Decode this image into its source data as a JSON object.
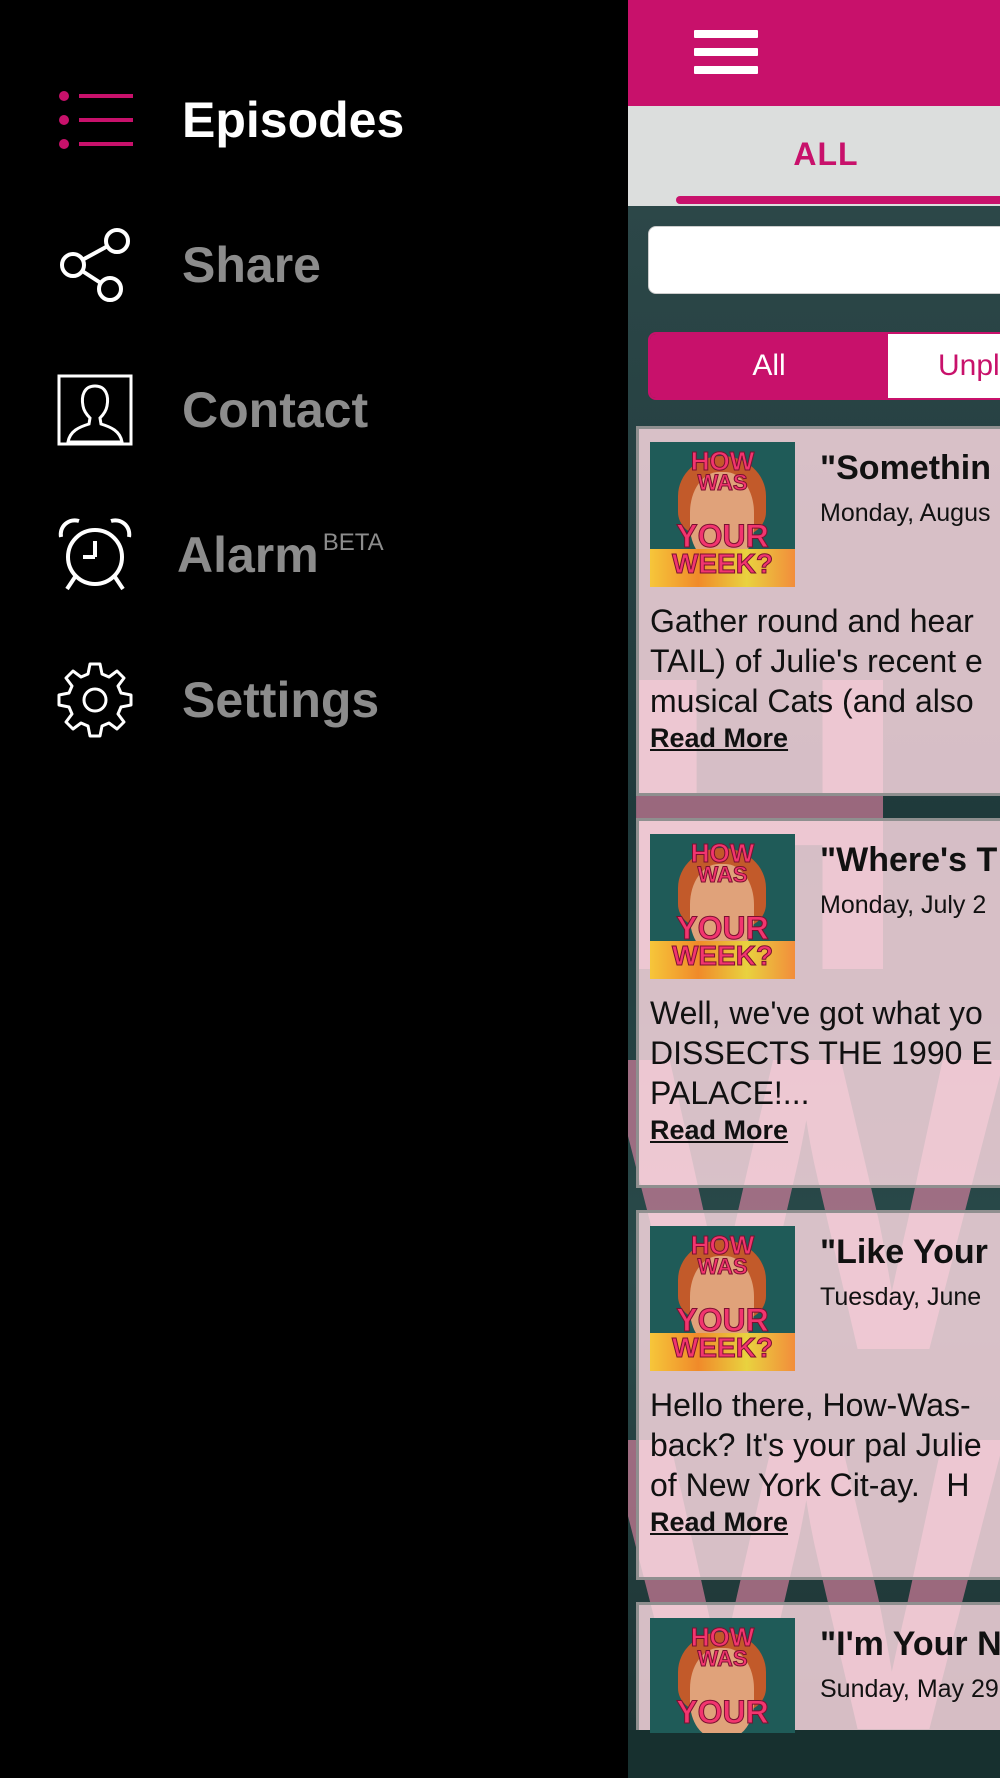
{
  "drawer": {
    "items": [
      {
        "label": "Episodes",
        "icon": "list-icon",
        "active": true
      },
      {
        "label": "Share",
        "icon": "share-icon"
      },
      {
        "label": "Contact",
        "icon": "contact-icon"
      },
      {
        "label": "Alarm",
        "badge": "BETA",
        "icon": "alarm-clock-icon"
      },
      {
        "label": "Settings",
        "icon": "gear-icon"
      }
    ]
  },
  "header": {
    "menu_icon": "hamburger-icon"
  },
  "tabs": [
    {
      "label": "ALL",
      "active": true
    }
  ],
  "search": {
    "value": "",
    "placeholder": ""
  },
  "filter": {
    "all_label": "All",
    "unplayed_label": "Unpl"
  },
  "colors": {
    "accent": "#c8116b",
    "drawer_bg": "#000000",
    "active_text": "#ffffff",
    "inactive_text": "#8c8c8c"
  },
  "thumbnail": {
    "line1": "HOW",
    "line2": "WAS",
    "line3": "YOUR",
    "line4": "WEEK?"
  },
  "episodes": [
    {
      "title": "\"Somethin",
      "date": "Monday, Augus",
      "desc": "Gather round and hear\nTAIL) of Julie's recent e\nmusical Cats (and also",
      "read_more": "Read More"
    },
    {
      "title": "\"Where's T",
      "date": "Monday, July 2",
      "desc": "Well, we've got what yo\nDISSECTS THE 1990 E\nPALACE!...",
      "read_more": "Read More"
    },
    {
      "title": "\"Like Your",
      "date": "Tuesday, June",
      "desc": "Hello there, How-Was-\nback? It's your pal Julie\nof New York Cit-ay.   H",
      "read_more": "Read More"
    },
    {
      "title": "\"I'm Your N",
      "date": "Sunday, May 29",
      "desc": "",
      "read_more": ""
    }
  ]
}
